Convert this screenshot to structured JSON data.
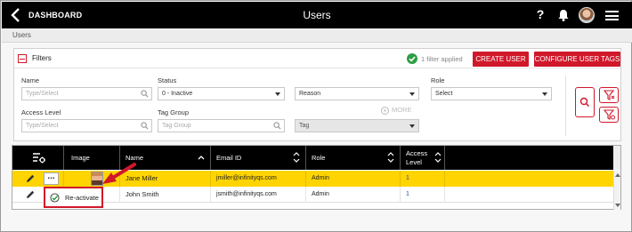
{
  "topbar": {
    "back_label": "DASHBOARD",
    "title": "Users",
    "help": "?"
  },
  "breadcrumb": "Users",
  "filters": {
    "title": "Filters",
    "applied": "1 filter applied",
    "create_user": "CREATE USER",
    "configure_tags": "CONFIGURE USER TAGS",
    "name_label": "Name",
    "name_placeholder": "Type/Select",
    "status_label": "Status",
    "status_value": "0 - Inactive",
    "reason_value": "Reason",
    "role_label": "Role",
    "role_value": "Select",
    "access_label": "Access Level",
    "access_placeholder": "Type/Select",
    "taggroup_label": "Tag Group",
    "taggroup_placeholder": "Tag Group",
    "tag_value": "Tag",
    "more": "MORE"
  },
  "grid": {
    "columns": [
      "Image",
      "Name",
      "Email ID",
      "Role",
      "Access",
      "Level"
    ],
    "rows": [
      {
        "name": "Jane Miller",
        "email": "jmiller@infinityqs.com",
        "role": "Admin",
        "access": "1"
      },
      {
        "name": "John Smith",
        "email": "jsmith@infinityqs.com",
        "role": "Admin",
        "access": "1"
      }
    ],
    "more_menu": "...",
    "popup_action": "Re-activate"
  },
  "colors": {
    "accent": "#d0182a",
    "selected_row": "#ffd400",
    "header": "#000000"
  }
}
